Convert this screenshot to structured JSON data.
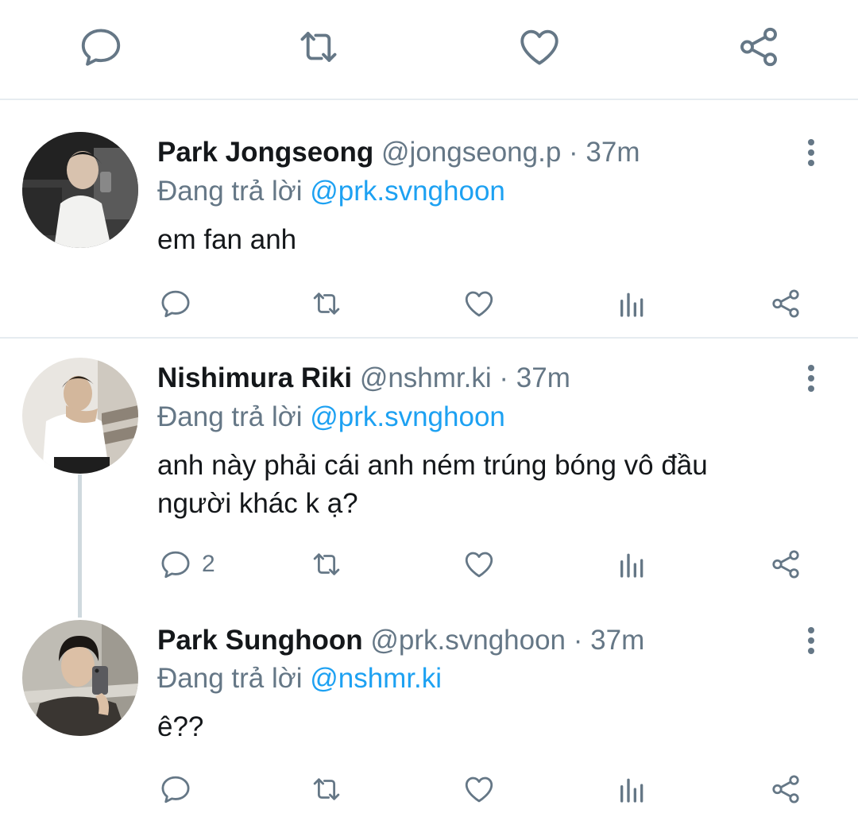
{
  "tweets": [
    {
      "name": "Park Jongseong",
      "handle": "@jongseong.p",
      "sep": "·",
      "time": "37m",
      "reply_prefix": "Đang trả lời",
      "reply_to": "@prk.svnghoon",
      "text": "em fan anh",
      "reply_count": ""
    },
    {
      "name": "Nishimura Riki",
      "handle": "@nshmr.ki",
      "sep": "·",
      "time": "37m",
      "reply_prefix": "Đang trả lời",
      "reply_to": "@prk.svnghoon",
      "text_line1": "anh này phải cái anh ném trúng bóng vô đầu",
      "text_line2": "người khác k ạ?",
      "reply_count": "2"
    },
    {
      "name": "Park Sunghoon",
      "handle": "@prk.svnghoon",
      "sep": "·",
      "time": "37m",
      "reply_prefix": "Đang trả lời",
      "reply_to": "@nshmr.ki",
      "text": "ê??",
      "reply_count": ""
    }
  ],
  "icons": {
    "reply": "reply-icon",
    "retweet": "retweet-icon",
    "like": "heart-icon",
    "analytics": "analytics-icon",
    "share": "share-icon",
    "more": "more-vertical-icon"
  },
  "colors": {
    "mention": "#1da1f2",
    "secondary": "#657786",
    "icon": "#657786",
    "divider": "#e6ecf0",
    "thread_line": "#cfd9de"
  }
}
